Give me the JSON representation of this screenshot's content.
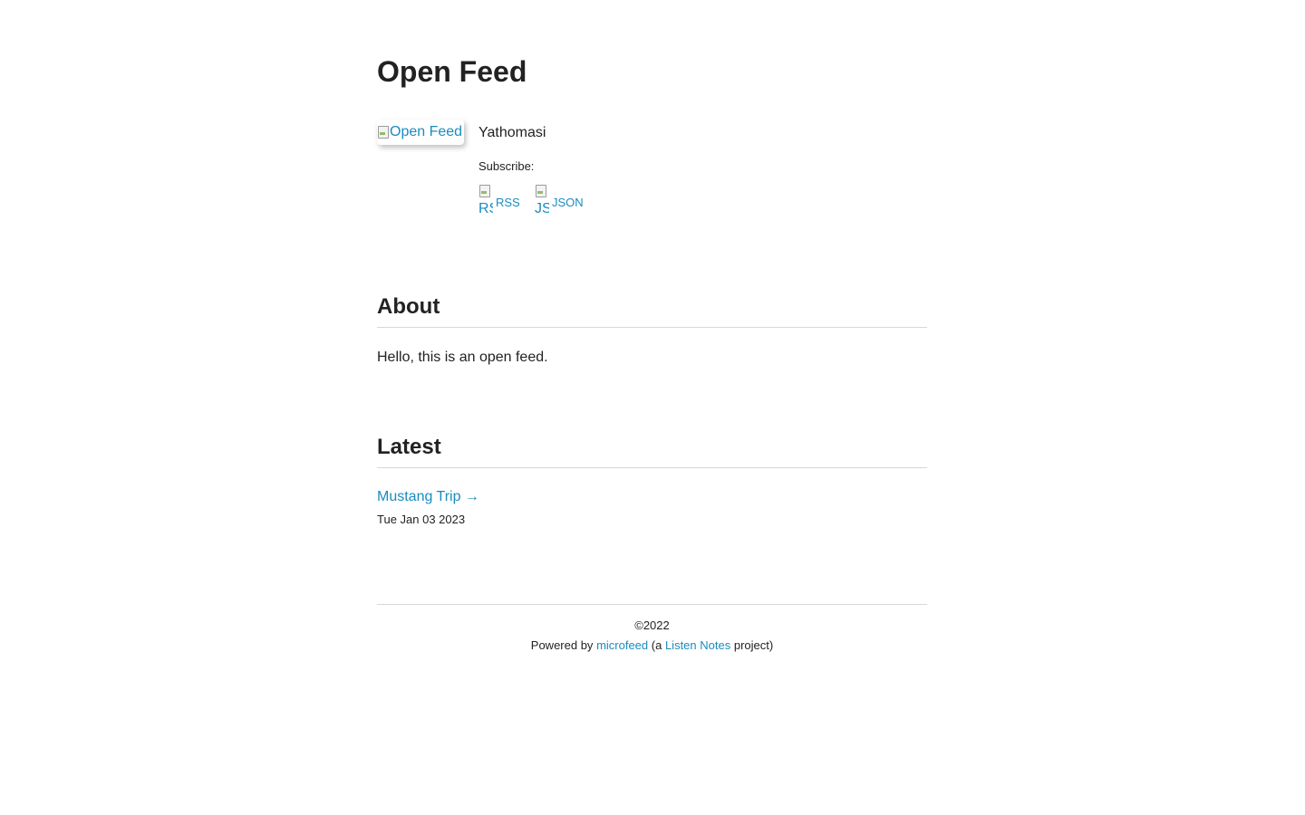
{
  "header": {
    "title": "Open Feed"
  },
  "channel": {
    "cover_alt": "Open Feed",
    "author": "Yathomasi",
    "subscribe_label": "Subscribe:",
    "subscribe_links": [
      {
        "icon_alt": "RSS",
        "label": "RSS",
        "icon": "rss-icon"
      },
      {
        "icon_alt": "JSON",
        "label": "JSON",
        "icon": "json-icon"
      }
    ]
  },
  "about": {
    "heading": "About",
    "text": "Hello, this is an open feed."
  },
  "latest": {
    "heading": "Latest",
    "items": [
      {
        "title": "Mustang Trip →",
        "date": "Tue Jan 03 2023"
      }
    ]
  },
  "footer": {
    "copyright": "©2022",
    "powered_prefix": "Powered by",
    "microfeed_link": "microfeed",
    "middle_text": "(a",
    "listen_notes_link": "Listen Notes",
    "suffix": "project)"
  },
  "colors": {
    "link": "#1a8cbf",
    "text": "#222222",
    "rule": "#d8d8d8"
  }
}
